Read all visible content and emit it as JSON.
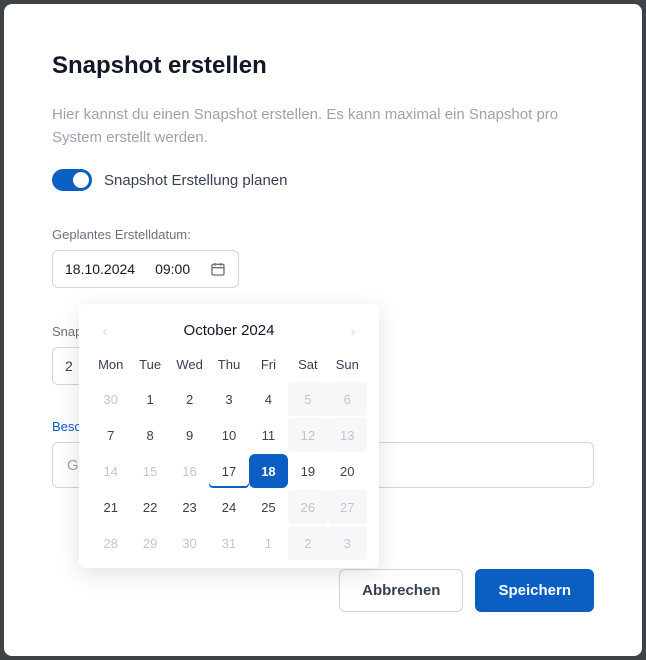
{
  "dialog": {
    "title": "Snapshot erstellen",
    "description": "Hier kannst du einen Snapshot erstellen. Es kann maximal ein Snapshot pro System erstellt werden.",
    "toggle_label": "Snapshot Erstellung planen",
    "toggle_on": true
  },
  "scheduled": {
    "label": "Geplantes Erstelldatum:",
    "date_value": "18.10.2024",
    "time_value": "09:00",
    "calendar_icon": "calendar-icon"
  },
  "name_field": {
    "label": "Snap",
    "value": "2"
  },
  "desc_field": {
    "label": "Besc",
    "placeholder": "G"
  },
  "buttons": {
    "cancel": "Abbrechen",
    "save": "Speichern"
  },
  "calendar": {
    "title": "October 2024",
    "prev": "‹",
    "next": "›",
    "dow": [
      "Mon",
      "Tue",
      "Wed",
      "Thu",
      "Fri",
      "Sat",
      "Sun"
    ],
    "today": 17,
    "selected": 18,
    "cells": [
      {
        "d": 30,
        "cls": "adjacent"
      },
      {
        "d": 1
      },
      {
        "d": 2
      },
      {
        "d": 3
      },
      {
        "d": 4
      },
      {
        "d": 5,
        "cls": "weekend-muted"
      },
      {
        "d": 6,
        "cls": "weekend-muted"
      },
      {
        "d": 7
      },
      {
        "d": 8
      },
      {
        "d": 9
      },
      {
        "d": 10
      },
      {
        "d": 11
      },
      {
        "d": 12,
        "cls": "weekend-muted"
      },
      {
        "d": 13,
        "cls": "weekend-muted"
      },
      {
        "d": 14,
        "cls": "muted"
      },
      {
        "d": 15,
        "cls": "muted"
      },
      {
        "d": 16,
        "cls": "muted"
      },
      {
        "d": 17,
        "cls": "today"
      },
      {
        "d": 18,
        "cls": "selected"
      },
      {
        "d": 19
      },
      {
        "d": 20
      },
      {
        "d": 21
      },
      {
        "d": 22
      },
      {
        "d": 23
      },
      {
        "d": 24
      },
      {
        "d": 25
      },
      {
        "d": 26,
        "cls": "weekend-muted"
      },
      {
        "d": 27,
        "cls": "weekend-muted"
      },
      {
        "d": 28,
        "cls": "muted"
      },
      {
        "d": 29,
        "cls": "muted"
      },
      {
        "d": 30,
        "cls": "muted"
      },
      {
        "d": 31,
        "cls": "muted"
      },
      {
        "d": 1,
        "cls": "adjacent"
      },
      {
        "d": 2,
        "cls": "weekend-muted"
      },
      {
        "d": 3,
        "cls": "weekend-muted"
      }
    ]
  }
}
